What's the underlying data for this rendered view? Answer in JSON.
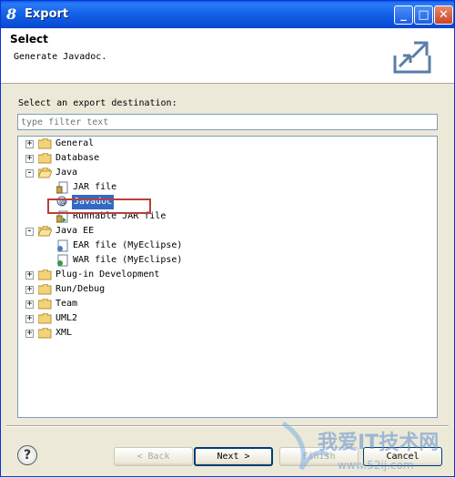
{
  "window": {
    "title": "Export"
  },
  "header": {
    "title": "Select",
    "subtitle": "Generate Javadoc."
  },
  "labels": {
    "destination": "Select an export destination:"
  },
  "filter": {
    "placeholder": "type filter text"
  },
  "tree": {
    "items": [
      {
        "label": "General",
        "expander": "+"
      },
      {
        "label": "Database",
        "expander": "+"
      },
      {
        "label": "Java",
        "expander": "-"
      },
      {
        "label": "JAR file"
      },
      {
        "label": "Javadoc",
        "selected": true
      },
      {
        "label": "Runnable JAR file"
      },
      {
        "label": "Java EE",
        "expander": "-"
      },
      {
        "label": "EAR file (MyEclipse)"
      },
      {
        "label": "WAR file (MyEclipse)"
      },
      {
        "label": "Plug-in Development",
        "expander": "+"
      },
      {
        "label": "Run/Debug",
        "expander": "+"
      },
      {
        "label": "Team",
        "expander": "+"
      },
      {
        "label": "UML2",
        "expander": "+"
      },
      {
        "label": "XML",
        "expander": "+"
      }
    ]
  },
  "buttons": {
    "back": "< Back",
    "next": "Next >",
    "finish": "Finish",
    "cancel": "Cancel",
    "help": "?"
  },
  "watermark": {
    "text": "我爱IT技术网",
    "url": "www.52ij.com"
  },
  "colors": {
    "titlebar": "#0a5ee6",
    "selection": "#316ac5",
    "highlight_box": "#b8403a",
    "folder": "#f3d27a"
  }
}
